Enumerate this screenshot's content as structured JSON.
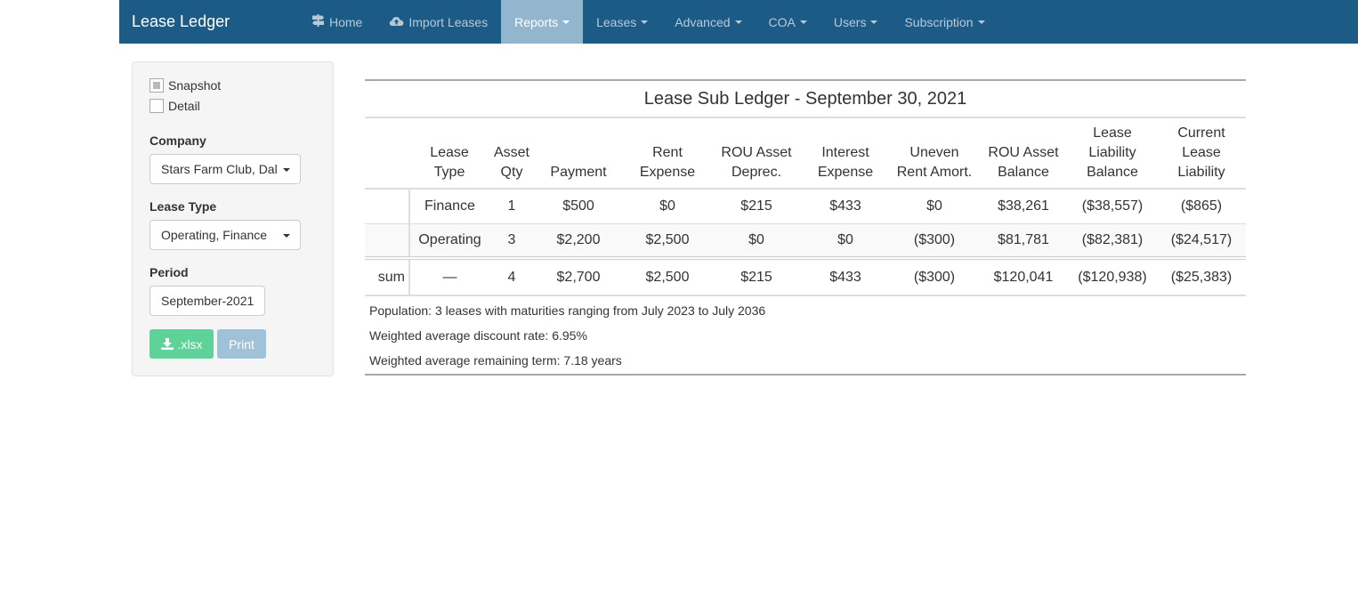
{
  "nav": {
    "brand": "Lease Ledger",
    "items": [
      {
        "label": "Home",
        "icon": "signpost-icon",
        "dropdown": false,
        "active": false
      },
      {
        "label": "Import Leases",
        "icon": "cloud-upload-icon",
        "dropdown": false,
        "active": false
      },
      {
        "label": "Reports",
        "dropdown": true,
        "active": true
      },
      {
        "label": "Leases",
        "dropdown": true,
        "active": false
      },
      {
        "label": "Advanced",
        "dropdown": true,
        "active": false
      },
      {
        "label": "COA",
        "dropdown": true,
        "active": false
      },
      {
        "label": "Users",
        "dropdown": true,
        "active": false
      },
      {
        "label": "Subscription",
        "dropdown": true,
        "active": false
      }
    ],
    "colors": {
      "bar": "#1d5b87",
      "active": "#93b6cf"
    }
  },
  "sidebar": {
    "snapshot": {
      "label": "Snapshot",
      "checked": true
    },
    "detail": {
      "label": "Detail",
      "checked": false
    },
    "company": {
      "label": "Company",
      "value": "Stars Farm Club, Dal"
    },
    "lease_type": {
      "label": "Lease Type",
      "value": "Operating, Finance"
    },
    "period": {
      "label": "Period",
      "value": "September-2021"
    },
    "xlsx_label": ".xlsx",
    "print_label": "Print"
  },
  "report": {
    "title": "Lease Sub Ledger - September 30, 2021",
    "headers": [
      [
        "Lease",
        "Type"
      ],
      [
        "Asset",
        "Qty"
      ],
      [
        "Payment"
      ],
      [
        "Rent",
        "Expense"
      ],
      [
        "ROU Asset",
        "Deprec."
      ],
      [
        "Interest",
        "Expense"
      ],
      [
        "Uneven",
        "Rent Amort."
      ],
      [
        "ROU Asset",
        "Balance"
      ],
      [
        "Lease",
        "Liability",
        "Balance"
      ],
      [
        "Current",
        "Lease",
        "Liability"
      ]
    ],
    "rows": [
      [
        "Finance",
        "1",
        "$500",
        "$0",
        "$215",
        "$433",
        "$0",
        "$38,261",
        "($38,557)",
        "($865)"
      ],
      [
        "Operating",
        "3",
        "$2,200",
        "$2,500",
        "$0",
        "$0",
        "($300)",
        "$81,781",
        "($82,381)",
        "($24,517)"
      ]
    ],
    "sum": {
      "label": "sum",
      "values": [
        "—",
        "4",
        "$2,700",
        "$2,500",
        "$215",
        "$433",
        "($300)",
        "$120,041",
        "($120,938)",
        "($25,383)"
      ]
    },
    "notes": [
      "Population: 3 leases with maturities ranging from July 2023 to July 2036",
      "Weighted average discount rate: 6.95%",
      "Weighted average remaining term: 7.18 years"
    ]
  }
}
